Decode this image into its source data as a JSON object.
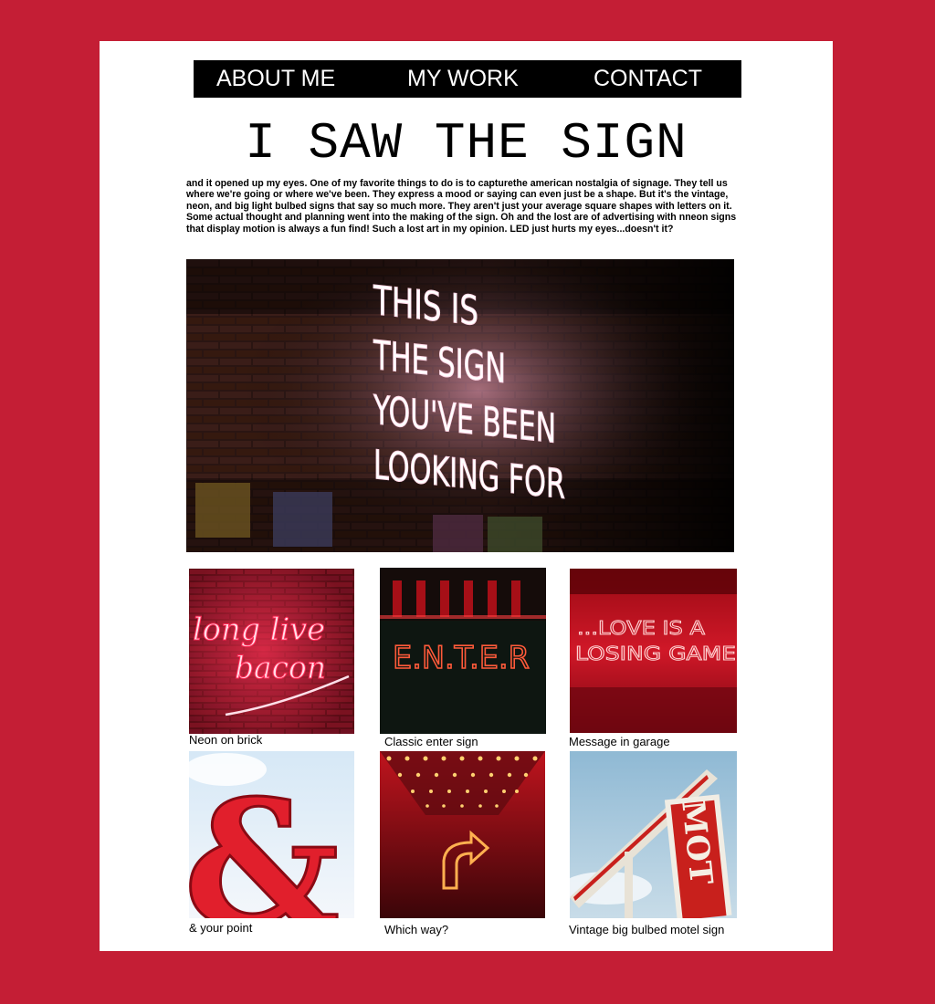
{
  "nav": {
    "items": [
      {
        "label": "ABOUT ME"
      },
      {
        "label": "MY WORK"
      },
      {
        "label": "CONTACT"
      }
    ]
  },
  "page": {
    "title": "I SAW THE SIGN",
    "intro": "and it opened up my eyes. One of my favorite things to do is to capturethe american nostalgia of signage. They tell us where we're going or where we've been. They express a mood or saying can even just be a shape. But it's the vintage, neon, and big light bulbed signs that say so much more. They aren't just your average square shapes with letters on it. Some actual thought and planning went into the making of the sign. Oh and the lost are of advertising with nneon signs that display motion is always a fun find! Such a lost art in my opinion. LED just hurts my eyes...doesn't it?"
  },
  "hero": {
    "sign_lines": [
      "THIS IS",
      "THE SIGN",
      "YOU'VE BEEN",
      "LOOKING FOR"
    ]
  },
  "gallery": {
    "items": [
      {
        "caption": "Neon on brick",
        "sign_text": [
          "long live",
          "bacon"
        ]
      },
      {
        "caption": "Classic enter sign",
        "sign_text": [
          "E.N.T.E.R"
        ]
      },
      {
        "caption": "Message in garage",
        "sign_text": [
          "...LOVE IS A",
          "LOSING GAME"
        ]
      },
      {
        "caption": "& your point",
        "sign_text": [
          "&"
        ]
      },
      {
        "caption": "Which way?",
        "sign_text": []
      },
      {
        "caption": "Vintage big bulbed motel sign",
        "sign_text": [
          "MOT"
        ]
      }
    ]
  },
  "colors": {
    "background": "#c41e35",
    "nav_bg": "#000000",
    "neon_red": "#ff3344"
  }
}
